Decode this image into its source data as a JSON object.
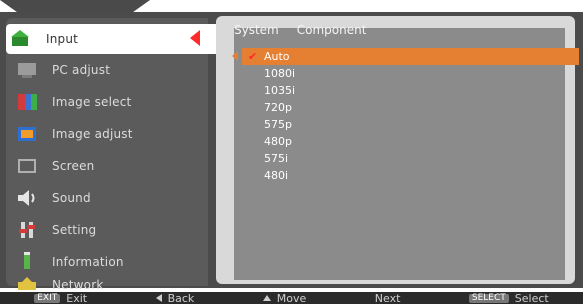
{
  "menu": {
    "items": [
      {
        "label": "Input",
        "icon": "input-icon",
        "active": true
      },
      {
        "label": "PC adjust",
        "icon": "pc-adjust-icon",
        "active": false
      },
      {
        "label": "Image select",
        "icon": "image-select-icon",
        "active": false
      },
      {
        "label": "Image adjust",
        "icon": "image-adjust-icon",
        "active": false
      },
      {
        "label": "Screen",
        "icon": "screen-icon",
        "active": false
      },
      {
        "label": "Sound",
        "icon": "sound-icon",
        "active": false
      },
      {
        "label": "Setting",
        "icon": "setting-icon",
        "active": false
      },
      {
        "label": "Information",
        "icon": "information-icon",
        "active": false
      },
      {
        "label": "Network",
        "icon": "network-icon",
        "active": false
      }
    ]
  },
  "content": {
    "header_left": "System",
    "header_right": "Component",
    "options": [
      {
        "label": "Auto",
        "selected": true
      },
      {
        "label": "1080i"
      },
      {
        "label": "1035i"
      },
      {
        "label": "720p"
      },
      {
        "label": "575p"
      },
      {
        "label": "480p"
      },
      {
        "label": "575i"
      },
      {
        "label": "480i"
      }
    ],
    "check_symbol": "✔"
  },
  "footer": {
    "exit_key": "EXIT",
    "exit_label": "Exit",
    "back_label": "Back",
    "move_label": "Move",
    "next_label": "Next",
    "select_key": "SELECT",
    "select_label": "Select"
  },
  "colors": {
    "panel": "#4b4b4b",
    "sidebar": "#5b5b5b",
    "content": "#8b8b8b",
    "selected_row": "#e57f32",
    "active_mark": "#ff2a2a"
  }
}
